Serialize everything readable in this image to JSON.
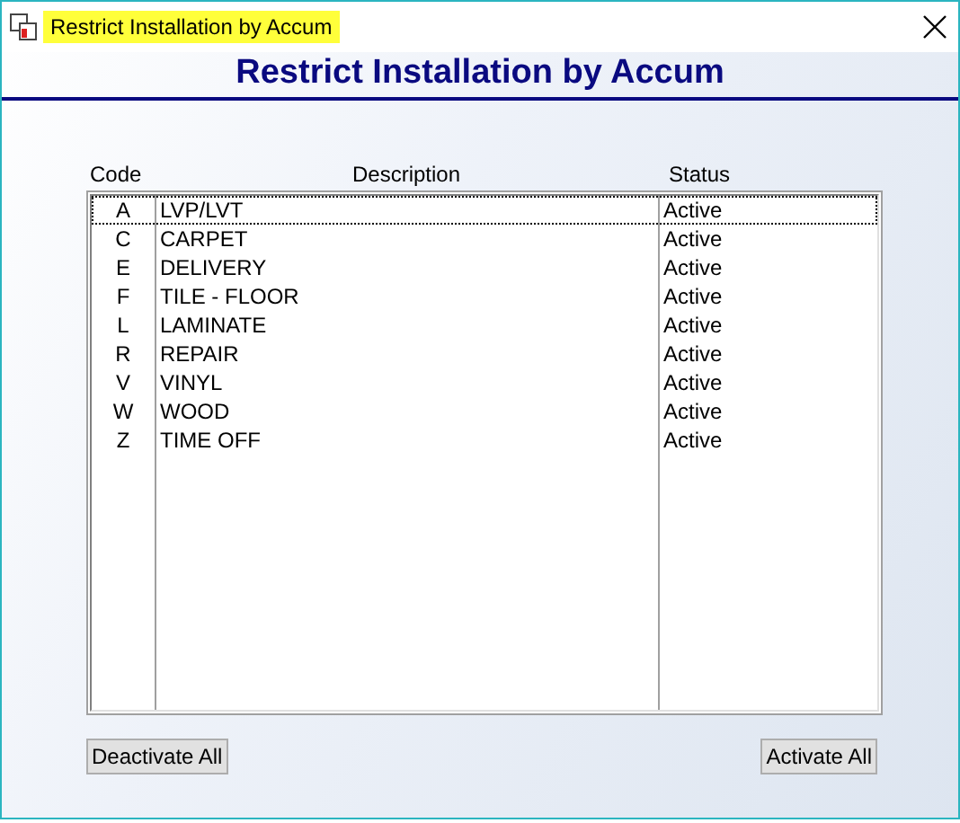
{
  "window": {
    "title": "Restrict Installation by Accum"
  },
  "heading": "Restrict Installation by Accum",
  "table": {
    "columns": [
      "Code",
      "Description",
      "Status"
    ],
    "rows": [
      {
        "code": "A",
        "description": "LVP/LVT",
        "status": "Active",
        "selected": true
      },
      {
        "code": "C",
        "description": "CARPET",
        "status": "Active",
        "selected": false
      },
      {
        "code": "E",
        "description": "DELIVERY",
        "status": "Active",
        "selected": false
      },
      {
        "code": "F",
        "description": "TILE - FLOOR",
        "status": "Active",
        "selected": false
      },
      {
        "code": "L",
        "description": "LAMINATE",
        "status": "Active",
        "selected": false
      },
      {
        "code": "R",
        "description": "REPAIR",
        "status": "Active",
        "selected": false
      },
      {
        "code": "V",
        "description": "VINYL",
        "status": "Active",
        "selected": false
      },
      {
        "code": "W",
        "description": "WOOD",
        "status": "Active",
        "selected": false
      },
      {
        "code": "Z",
        "description": "TIME OFF",
        "status": "Active",
        "selected": false
      }
    ]
  },
  "buttons": [
    "Deactivate All",
    "Activate All"
  ]
}
